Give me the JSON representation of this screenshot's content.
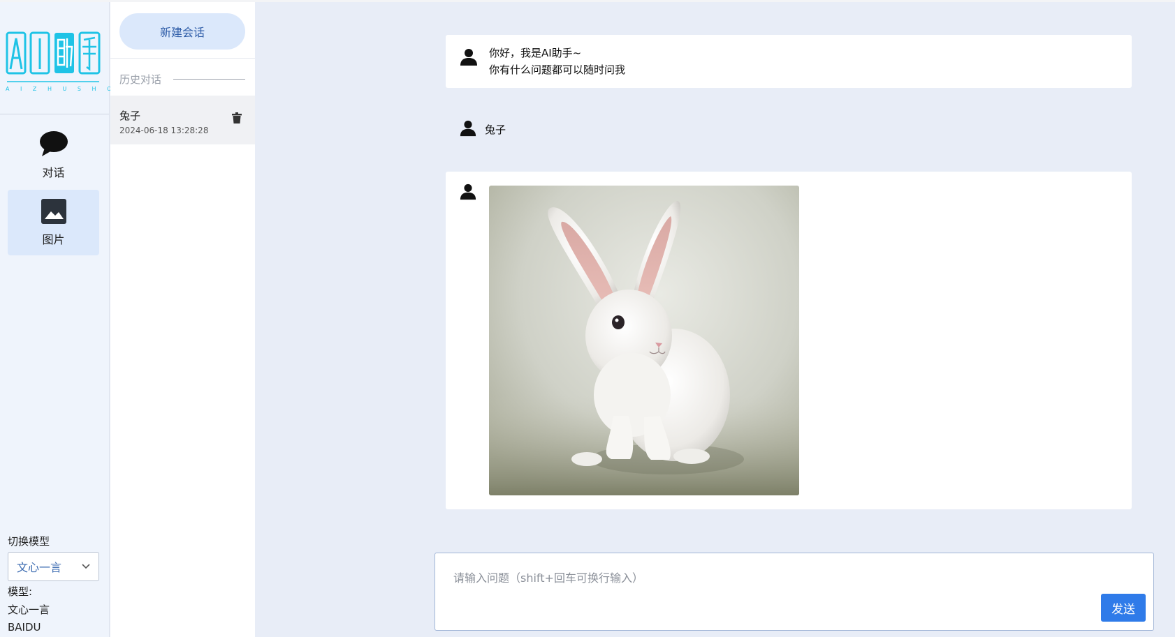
{
  "logo": {
    "text": "AI助手",
    "subtitle": "A I Z H U S H O U"
  },
  "nav": {
    "items": [
      {
        "label": "对话",
        "icon": "chat-bubble-icon",
        "active": false
      },
      {
        "label": "图片",
        "icon": "image-icon",
        "active": true
      }
    ]
  },
  "model": {
    "title": "切换模型",
    "selected": "文心一言",
    "info_label": "模型:",
    "info_name": "文心一言",
    "info_vendor": "BAIDU"
  },
  "history": {
    "new_chat_label": "新建会话",
    "section_title": "历史对话",
    "items": [
      {
        "name": "兔子",
        "time": "2024-06-18 13:28:28"
      }
    ]
  },
  "messages": [
    {
      "role": "assistant",
      "lines": [
        "你好，我是AI助手~",
        "你有什么问题都可以随时问我"
      ]
    },
    {
      "role": "user",
      "text": "兔子"
    },
    {
      "role": "assistant",
      "image": "white-rabbit-image"
    }
  ],
  "input": {
    "placeholder": "请输入问题（shift+回车可换行输入）",
    "send_label": "发送"
  },
  "colors": {
    "accent": "#2f7be9",
    "active_nav": "#dbe8fb",
    "background": "#e8edf7",
    "logo_cyan": "#1fc3e6"
  }
}
